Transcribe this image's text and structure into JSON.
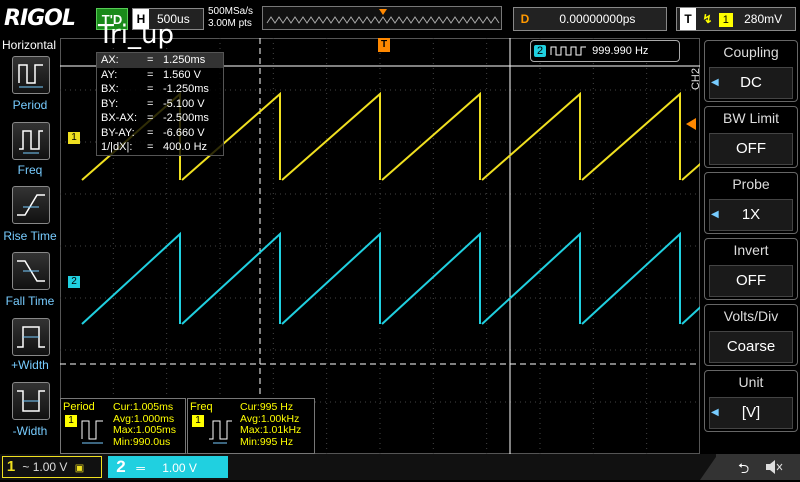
{
  "header": {
    "logo": "RIGOL",
    "trigger_status": "T'D",
    "horizontal_label": "H",
    "timebase": "500us",
    "sample_rate": "500MSa/s",
    "memory_depth": "3.00M pts",
    "delay_label": "D",
    "delay_value": "0.00000000ps",
    "trigger_label": "T",
    "trigger_channel": "1",
    "trigger_level": "280mV"
  },
  "overlay_title": "Tri_up",
  "left_menu": {
    "title": "Horizontal",
    "items": [
      {
        "label": "Period"
      },
      {
        "label": "Freq"
      },
      {
        "label": "Rise Time"
      },
      {
        "label": "Fall Time"
      },
      {
        "label": "+Width"
      },
      {
        "label": "-Width"
      }
    ]
  },
  "cursor_readout": {
    "rows": [
      {
        "key": "AX:",
        "eq": "=",
        "val": "1.250ms"
      },
      {
        "key": "AY:",
        "eq": "=",
        "val": "1.560 V"
      },
      {
        "key": "BX:",
        "eq": "=",
        "val": "-1.250ms"
      },
      {
        "key": "BY:",
        "eq": "=",
        "val": "-5.100 V"
      },
      {
        "key": "BX-AX:",
        "eq": "=",
        "val": "-2.500ms"
      },
      {
        "key": "BY-AY:",
        "eq": "=",
        "val": "-6.660 V"
      },
      {
        "key": "1/|dX|:",
        "eq": "=",
        "val": "400.0 Hz"
      }
    ]
  },
  "ch2_freq": {
    "channel": "2",
    "value": "999.990 Hz"
  },
  "right_menu": {
    "channel": "CH2",
    "items": [
      {
        "title": "Coupling",
        "value": "DC"
      },
      {
        "title": "BW Limit",
        "value": "OFF"
      },
      {
        "title": "Probe",
        "value": "1X"
      },
      {
        "title": "Invert",
        "value": "OFF"
      },
      {
        "title": "Volts/Div",
        "value": "Coarse"
      },
      {
        "title": "Unit",
        "value": "[V]"
      }
    ]
  },
  "measurements": [
    {
      "title": "Period",
      "channel": "1",
      "cur": "Cur:1.005ms",
      "avg": "Avg:1.000ms",
      "max": "Max:1.005ms",
      "min": "Min:990.0us"
    },
    {
      "title": "Freq",
      "channel": "1",
      "cur": "Cur:995 Hz",
      "avg": "Avg:1.00kHz",
      "max": "Max:1.01kHz",
      "min": "Min:995 Hz"
    }
  ],
  "bottom": {
    "ch1_num": "1",
    "ch1_scale": "1.00 V",
    "ch2_num": "2",
    "ch2_scale": "1.00 V"
  },
  "markers": {
    "ch1": "1",
    "ch2": "2",
    "trigger": "T"
  },
  "colors": {
    "ch1": "#f0e020",
    "ch2": "#20d0e0",
    "trigger": "#ff8800",
    "grid": "#444444"
  }
}
